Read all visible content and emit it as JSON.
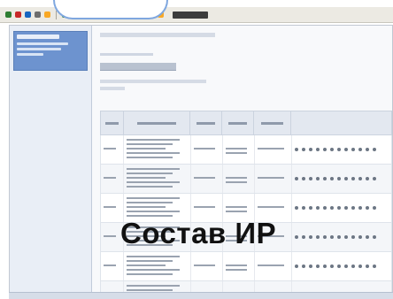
{
  "overlay_caption": "Состав ИР",
  "colors": {
    "accent_blue": "#6d93cf",
    "toolbar_bg": "#eceae3",
    "cloud_border": "#7fa7df"
  },
  "toolbar": {
    "icons": [
      "back-icon",
      "forward-icon",
      "stop-icon",
      "refresh-icon",
      "home-icon",
      "search-icon",
      "favorites-icon",
      "history-icon",
      "mail-icon",
      "print-icon",
      "edit-icon",
      "discuss-icon",
      "messenger-icon",
      "research-icon",
      "tools-icon"
    ]
  },
  "table": {
    "column_count": 8,
    "rows": 6
  }
}
